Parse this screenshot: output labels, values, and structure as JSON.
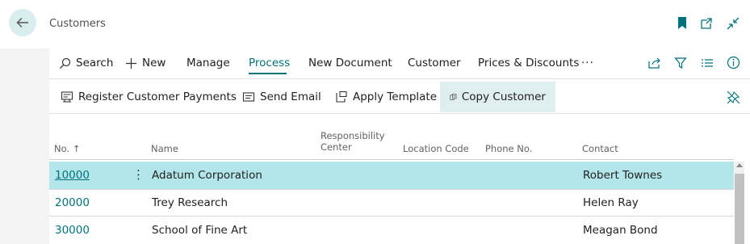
{
  "header": {
    "title": "Customers",
    "back_icon": "arrow-left-icon",
    "bookmark_icon": "bookmark-icon",
    "open_new_icon": "open-in-new-window-icon",
    "collapse_icon": "collapse-icon",
    "accent_color": "#00727a"
  },
  "menu": {
    "search": "Search",
    "new": "New",
    "manage": "Manage",
    "process": "Process",
    "new_document": "New Document",
    "customer": "Customer",
    "prices_discounts": "Prices & Discounts",
    "more": "···",
    "active_tab": "Process"
  },
  "actions": {
    "register_payments": "Register Customer Payments",
    "send_email": "Send Email",
    "apply_template": "Apply Template",
    "copy_customer": "Copy Customer"
  },
  "table": {
    "headers": {
      "no": "No. ↑",
      "name": "Name",
      "responsibility_center_1": "Responsibility",
      "responsibility_center_2": "Center",
      "location_code": "Location Code",
      "phone_no": "Phone No.",
      "contact": "Contact"
    },
    "rows": [
      {
        "no": "10000",
        "name": "Adatum Corporation",
        "contact": "Robert Townes",
        "selected": true
      },
      {
        "no": "20000",
        "name": "Trey Research",
        "contact": "Helen Ray",
        "selected": false
      },
      {
        "no": "30000",
        "name": "School of Fine Art",
        "contact": "Meagan Bond",
        "selected": false
      }
    ],
    "row_menu": "⋮"
  }
}
